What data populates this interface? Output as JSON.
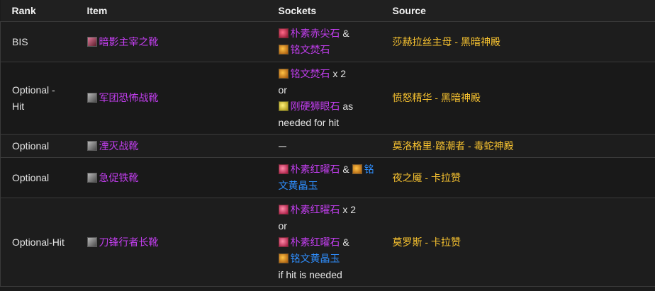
{
  "headers": {
    "rank": "Rank",
    "item": "Item",
    "sockets": "Sockets",
    "source": "Source"
  },
  "rows": [
    {
      "rank": "BIS",
      "item": "暗影主宰之靴",
      "sockets": {
        "line1_gem": "朴素赤尖石",
        "line1_suffix": " &",
        "line2_gem": "铭文焚石"
      },
      "source": "莎赫拉丝主母 - 黑暗神殿"
    },
    {
      "rank_line1": "Optional -",
      "rank_line2": "Hit",
      "item": "军团恐怖战靴",
      "sockets": {
        "line1_gem": "铭文焚石",
        "line1_suffix": " x 2",
        "or": "or",
        "line3_gem": "刚硬狮眼石",
        "line3_suffix": " as",
        "line4": "needed for hit"
      },
      "source": "愤怒精华 - 黑暗神殿"
    },
    {
      "rank": "Optional",
      "item": "湮灭战靴",
      "sockets": {
        "empty": "dash"
      },
      "source": "莫洛格里·踏潮者 - 毒蛇神殿"
    },
    {
      "rank": "Optional",
      "item": "急促铁靴",
      "sockets": {
        "line1_gem": "朴素红曜石",
        "amp": " & ",
        "line1_gem2_part1": "铭",
        "line2_gem2_part2": "文黄晶玉"
      },
      "source": "夜之魇 - 卡拉赞"
    },
    {
      "rank": "Optional-Hit",
      "item": "刀锋行者长靴",
      "sockets": {
        "line1_gem": "朴素红曜石",
        "line1_suffix": " x 2",
        "or": "or",
        "line3_gem": "朴素红曜石",
        "line3_suffix": " &",
        "line4_gem": "铭文黄晶玉",
        "line5": "if hit is needed"
      },
      "source": "莫罗斯 - 卡拉赞"
    }
  ]
}
